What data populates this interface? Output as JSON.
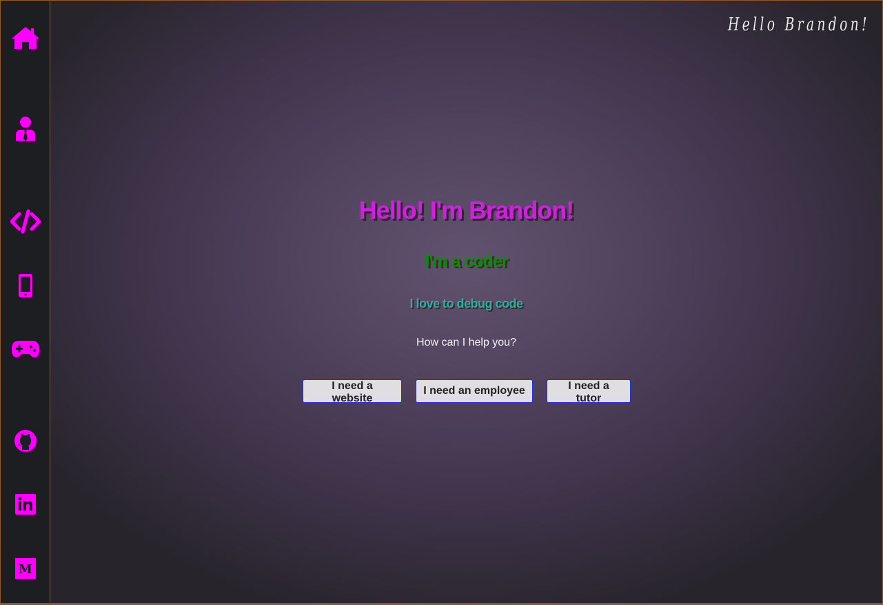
{
  "brand": {
    "signature": "Hello Brandon!"
  },
  "hero": {
    "title": "Hello! I'm Brandon!",
    "subtitle": "I'm a coder",
    "tagline": "I love to debug code",
    "prompt": "How can I help you?"
  },
  "buttons": {
    "website": "I need a website",
    "employee": "I need an employee",
    "tutor": "I need a tutor"
  },
  "sidebar": {
    "items": [
      {
        "icon": "home-icon"
      },
      {
        "icon": "user-tie-icon"
      },
      {
        "icon": "code-icon"
      },
      {
        "icon": "mobile-phone-icon"
      },
      {
        "icon": "gamepad-icon"
      },
      {
        "icon": "github-icon"
      },
      {
        "icon": "linkedin-icon"
      },
      {
        "icon": "medium-icon"
      }
    ]
  },
  "colors": {
    "accent": "#ff00ff",
    "title": "#cc22dd",
    "subtitle": "#0d8a0d",
    "tagline": "#3aa7a3",
    "sidebar_bg": "#1c1e21",
    "border": "#8a5a2c",
    "button_bg": "#e0dde3",
    "button_border": "#2a2fd0"
  }
}
